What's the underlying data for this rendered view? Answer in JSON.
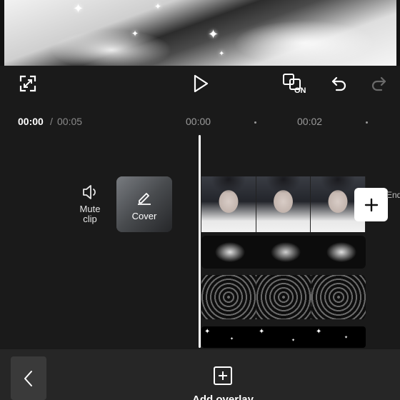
{
  "preview": {
    "label": "video preview"
  },
  "toolbar": {
    "fullscreen_icon": "fullscreen-icon",
    "play_icon": "play-icon",
    "compare_label": "ON",
    "undo_icon": "undo-icon",
    "redo_icon": "redo-icon"
  },
  "timecode": {
    "current": "00:00",
    "separator": "/",
    "total": "00:05",
    "ruler": [
      "00:00",
      "00:02"
    ]
  },
  "timeline": {
    "mute_label_line1": "Mute",
    "mute_label_line2": "clip",
    "cover_label": "Cover",
    "add_clip_icon": "plus-icon",
    "end_label": "End"
  },
  "bottom": {
    "back_icon": "chevron-left-icon",
    "add_overlay_label": "Add overlay"
  },
  "colors": {
    "background": "#1a1a1a",
    "bottom_bar": "#262626",
    "playhead": "#ffffff",
    "muted_text": "#8a8a8a"
  }
}
